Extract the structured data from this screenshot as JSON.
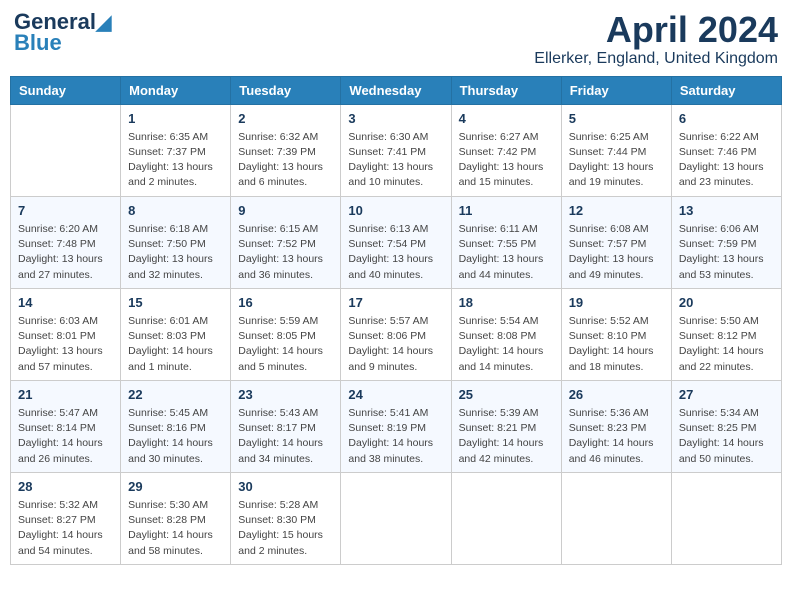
{
  "header": {
    "logo_line1": "General",
    "logo_line2": "Blue",
    "month": "April 2024",
    "location": "Ellerker, England, United Kingdom"
  },
  "days_of_week": [
    "Sunday",
    "Monday",
    "Tuesday",
    "Wednesday",
    "Thursday",
    "Friday",
    "Saturday"
  ],
  "weeks": [
    [
      {
        "day": "",
        "info": ""
      },
      {
        "day": "1",
        "info": "Sunrise: 6:35 AM\nSunset: 7:37 PM\nDaylight: 13 hours\nand 2 minutes."
      },
      {
        "day": "2",
        "info": "Sunrise: 6:32 AM\nSunset: 7:39 PM\nDaylight: 13 hours\nand 6 minutes."
      },
      {
        "day": "3",
        "info": "Sunrise: 6:30 AM\nSunset: 7:41 PM\nDaylight: 13 hours\nand 10 minutes."
      },
      {
        "day": "4",
        "info": "Sunrise: 6:27 AM\nSunset: 7:42 PM\nDaylight: 13 hours\nand 15 minutes."
      },
      {
        "day": "5",
        "info": "Sunrise: 6:25 AM\nSunset: 7:44 PM\nDaylight: 13 hours\nand 19 minutes."
      },
      {
        "day": "6",
        "info": "Sunrise: 6:22 AM\nSunset: 7:46 PM\nDaylight: 13 hours\nand 23 minutes."
      }
    ],
    [
      {
        "day": "7",
        "info": "Sunrise: 6:20 AM\nSunset: 7:48 PM\nDaylight: 13 hours\nand 27 minutes."
      },
      {
        "day": "8",
        "info": "Sunrise: 6:18 AM\nSunset: 7:50 PM\nDaylight: 13 hours\nand 32 minutes."
      },
      {
        "day": "9",
        "info": "Sunrise: 6:15 AM\nSunset: 7:52 PM\nDaylight: 13 hours\nand 36 minutes."
      },
      {
        "day": "10",
        "info": "Sunrise: 6:13 AM\nSunset: 7:54 PM\nDaylight: 13 hours\nand 40 minutes."
      },
      {
        "day": "11",
        "info": "Sunrise: 6:11 AM\nSunset: 7:55 PM\nDaylight: 13 hours\nand 44 minutes."
      },
      {
        "day": "12",
        "info": "Sunrise: 6:08 AM\nSunset: 7:57 PM\nDaylight: 13 hours\nand 49 minutes."
      },
      {
        "day": "13",
        "info": "Sunrise: 6:06 AM\nSunset: 7:59 PM\nDaylight: 13 hours\nand 53 minutes."
      }
    ],
    [
      {
        "day": "14",
        "info": "Sunrise: 6:03 AM\nSunset: 8:01 PM\nDaylight: 13 hours\nand 57 minutes."
      },
      {
        "day": "15",
        "info": "Sunrise: 6:01 AM\nSunset: 8:03 PM\nDaylight: 14 hours\nand 1 minute."
      },
      {
        "day": "16",
        "info": "Sunrise: 5:59 AM\nSunset: 8:05 PM\nDaylight: 14 hours\nand 5 minutes."
      },
      {
        "day": "17",
        "info": "Sunrise: 5:57 AM\nSunset: 8:06 PM\nDaylight: 14 hours\nand 9 minutes."
      },
      {
        "day": "18",
        "info": "Sunrise: 5:54 AM\nSunset: 8:08 PM\nDaylight: 14 hours\nand 14 minutes."
      },
      {
        "day": "19",
        "info": "Sunrise: 5:52 AM\nSunset: 8:10 PM\nDaylight: 14 hours\nand 18 minutes."
      },
      {
        "day": "20",
        "info": "Sunrise: 5:50 AM\nSunset: 8:12 PM\nDaylight: 14 hours\nand 22 minutes."
      }
    ],
    [
      {
        "day": "21",
        "info": "Sunrise: 5:47 AM\nSunset: 8:14 PM\nDaylight: 14 hours\nand 26 minutes."
      },
      {
        "day": "22",
        "info": "Sunrise: 5:45 AM\nSunset: 8:16 PM\nDaylight: 14 hours\nand 30 minutes."
      },
      {
        "day": "23",
        "info": "Sunrise: 5:43 AM\nSunset: 8:17 PM\nDaylight: 14 hours\nand 34 minutes."
      },
      {
        "day": "24",
        "info": "Sunrise: 5:41 AM\nSunset: 8:19 PM\nDaylight: 14 hours\nand 38 minutes."
      },
      {
        "day": "25",
        "info": "Sunrise: 5:39 AM\nSunset: 8:21 PM\nDaylight: 14 hours\nand 42 minutes."
      },
      {
        "day": "26",
        "info": "Sunrise: 5:36 AM\nSunset: 8:23 PM\nDaylight: 14 hours\nand 46 minutes."
      },
      {
        "day": "27",
        "info": "Sunrise: 5:34 AM\nSunset: 8:25 PM\nDaylight: 14 hours\nand 50 minutes."
      }
    ],
    [
      {
        "day": "28",
        "info": "Sunrise: 5:32 AM\nSunset: 8:27 PM\nDaylight: 14 hours\nand 54 minutes."
      },
      {
        "day": "29",
        "info": "Sunrise: 5:30 AM\nSunset: 8:28 PM\nDaylight: 14 hours\nand 58 minutes."
      },
      {
        "day": "30",
        "info": "Sunrise: 5:28 AM\nSunset: 8:30 PM\nDaylight: 15 hours\nand 2 minutes."
      },
      {
        "day": "",
        "info": ""
      },
      {
        "day": "",
        "info": ""
      },
      {
        "day": "",
        "info": ""
      },
      {
        "day": "",
        "info": ""
      }
    ]
  ]
}
